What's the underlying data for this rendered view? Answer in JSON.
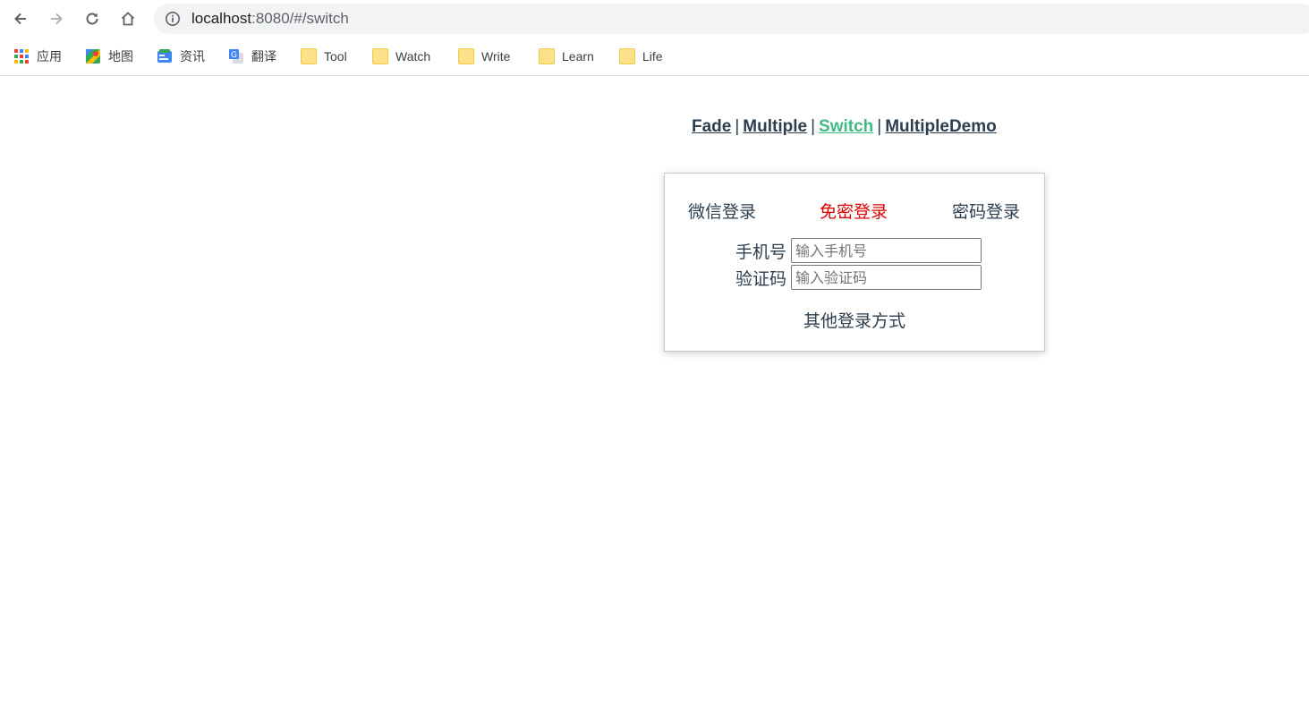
{
  "browser": {
    "url_host": "localhost",
    "url_path": ":8080/#/switch"
  },
  "bookmarks": [
    {
      "label": "应用",
      "icon": "apps-grid-icon"
    },
    {
      "label": "地图",
      "icon": "maps-icon"
    },
    {
      "label": "资讯",
      "icon": "news-icon"
    },
    {
      "label": "翻译",
      "icon": "translate-icon"
    },
    {
      "label": "Tool",
      "icon": "folder-icon"
    },
    {
      "label": "Watch",
      "icon": "folder-icon"
    },
    {
      "label": "Write",
      "icon": "folder-icon"
    },
    {
      "label": "Learn",
      "icon": "folder-icon"
    },
    {
      "label": "Life",
      "icon": "folder-icon"
    }
  ],
  "page_nav": {
    "links": [
      "Fade",
      "Multiple",
      "Switch",
      "MultipleDemo"
    ],
    "separator": "|",
    "active": "Switch",
    "active_color": "#42b983",
    "link_color": "#2c3e50"
  },
  "login": {
    "tabs": [
      "微信登录",
      "免密登录",
      "密码登录"
    ],
    "active_tab": "免密登录",
    "active_color": "#e00000",
    "phone_label": "手机号",
    "phone_placeholder": "输入手机号",
    "code_label": "验证码",
    "code_placeholder": "输入验证码",
    "other_methods": "其他登录方式"
  }
}
